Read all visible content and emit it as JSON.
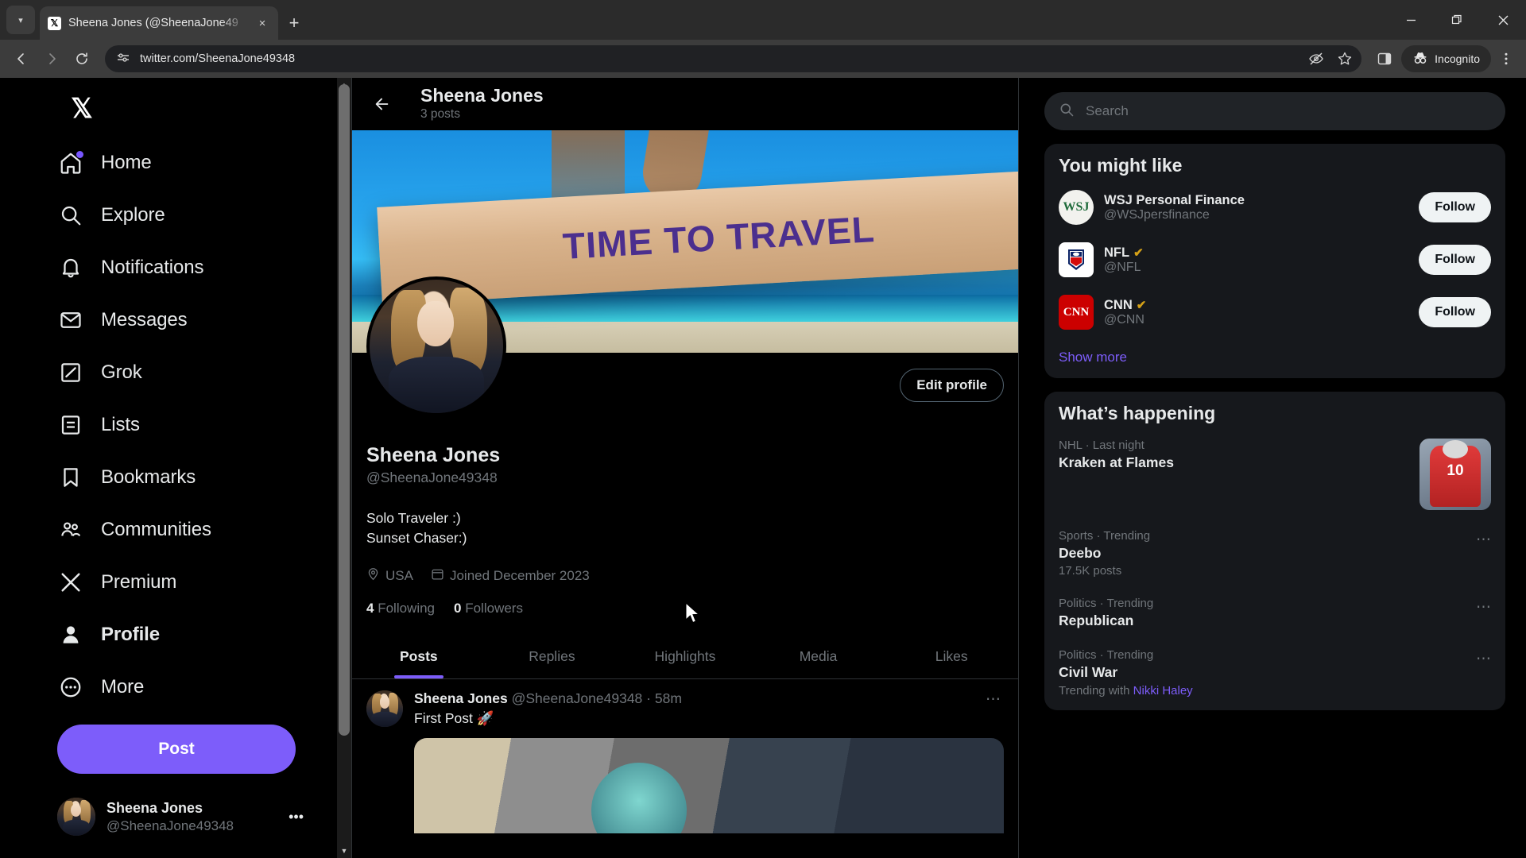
{
  "browser": {
    "tab": {
      "title": "Sheena Jones (@SheenaJone49",
      "favicon": "x-icon",
      "close": "×"
    },
    "new_tab_label": "+",
    "tab_list_icon": "chevron-down-icon",
    "window": {
      "minimize": "–",
      "maximize": "❐",
      "close": "✕"
    },
    "nav": {
      "back": "←",
      "forward": "→",
      "reload": "⟳"
    },
    "omnibox": {
      "url": "twitter.com/SheenaJone49348",
      "site_info_icon": "site-settings-icon",
      "tracking_icon": "eye-off-icon",
      "bookmark_icon": "star-icon"
    },
    "sidepanel_icon": "split-panel-icon",
    "incognito_label": "Incognito",
    "menu_icon": "kebab-menu-icon"
  },
  "sidebar": {
    "logo": "X",
    "items": [
      {
        "label": "Home",
        "icon": "home-icon",
        "active": false,
        "badge": true
      },
      {
        "label": "Explore",
        "icon": "search-icon",
        "active": false,
        "badge": false
      },
      {
        "label": "Notifications",
        "icon": "bell-icon",
        "active": false,
        "badge": false
      },
      {
        "label": "Messages",
        "icon": "envelope-icon",
        "active": false,
        "badge": false
      },
      {
        "label": "Grok",
        "icon": "grok-icon",
        "active": false,
        "badge": false
      },
      {
        "label": "Lists",
        "icon": "list-icon",
        "active": false,
        "badge": false
      },
      {
        "label": "Bookmarks",
        "icon": "bookmark-icon",
        "active": false,
        "badge": false
      },
      {
        "label": "Communities",
        "icon": "communities-icon",
        "active": false,
        "badge": false
      },
      {
        "label": "Premium",
        "icon": "x-icon",
        "active": false,
        "badge": false
      },
      {
        "label": "Profile",
        "icon": "person-icon",
        "active": true,
        "badge": false
      },
      {
        "label": "More",
        "icon": "more-circle-icon",
        "active": false,
        "badge": false
      }
    ],
    "post_button": "Post",
    "account": {
      "name": "Sheena Jones",
      "handle": "@SheenaJone49348",
      "more": "•••"
    }
  },
  "center": {
    "header": {
      "back_icon": "back-arrow-icon",
      "name": "Sheena Jones",
      "posts": "3 posts"
    },
    "banner_text": "TIME TO TRAVEL",
    "edit_profile": "Edit profile",
    "profile": {
      "name": "Sheena Jones",
      "handle": "@SheenaJone49348",
      "bio_line1": "Solo Traveler :)",
      "bio_line2": "Sunset Chaser:)",
      "location": "USA",
      "location_icon": "location-pin-icon",
      "joined": "Joined December 2023",
      "joined_icon": "calendar-icon",
      "following_count": "4",
      "following_label": "Following",
      "followers_count": "0",
      "followers_label": "Followers"
    },
    "tabs": [
      {
        "label": "Posts",
        "active": true
      },
      {
        "label": "Replies",
        "active": false
      },
      {
        "label": "Highlights",
        "active": false
      },
      {
        "label": "Media",
        "active": false
      },
      {
        "label": "Likes",
        "active": false
      }
    ],
    "tweet": {
      "author": "Sheena Jones",
      "handle": "@SheenaJone49348",
      "separator": "·",
      "time": "58m",
      "text": "First Post 🚀",
      "more_icon": "more-dots-icon"
    }
  },
  "right": {
    "search": {
      "placeholder": "Search",
      "icon": "search-icon"
    },
    "you_might_like": {
      "title": "You might like",
      "accounts": [
        {
          "name": "WSJ Personal Finance",
          "handle": "@WSJpersfinance",
          "verified": false,
          "avatar": "wsj",
          "avatar_text": "WSJ",
          "follow": "Follow"
        },
        {
          "name": "NFL",
          "handle": "@NFL",
          "verified": true,
          "avatar": "nfl",
          "avatar_text": "NFL",
          "follow": "Follow"
        },
        {
          "name": "CNN",
          "handle": "@CNN",
          "verified": true,
          "avatar": "cnn",
          "avatar_text": "CNN",
          "follow": "Follow"
        }
      ],
      "show_more": "Show more"
    },
    "whats_happening": {
      "title": "What’s happening",
      "items": [
        {
          "category": "NHL · Last night",
          "name": "Kraken at Flames",
          "posts": "",
          "thumb": true,
          "thumb_number": "10",
          "dots": false,
          "with": ""
        },
        {
          "category": "Sports · Trending",
          "name": "Deebo",
          "posts": "17.5K posts",
          "thumb": false,
          "dots": true,
          "with": ""
        },
        {
          "category": "Politics · Trending",
          "name": "Republican",
          "posts": "",
          "thumb": false,
          "dots": true,
          "with": ""
        },
        {
          "category": "Politics · Trending",
          "name": "Civil War",
          "posts": "",
          "thumb": false,
          "dots": true,
          "with": "Trending with ",
          "with_link": "Nikki Haley"
        }
      ]
    }
  },
  "colors": {
    "accent": "#7d5dfa",
    "background": "#000000",
    "card": "#16181c",
    "muted": "#71767b",
    "text": "#e7e9ea"
  }
}
